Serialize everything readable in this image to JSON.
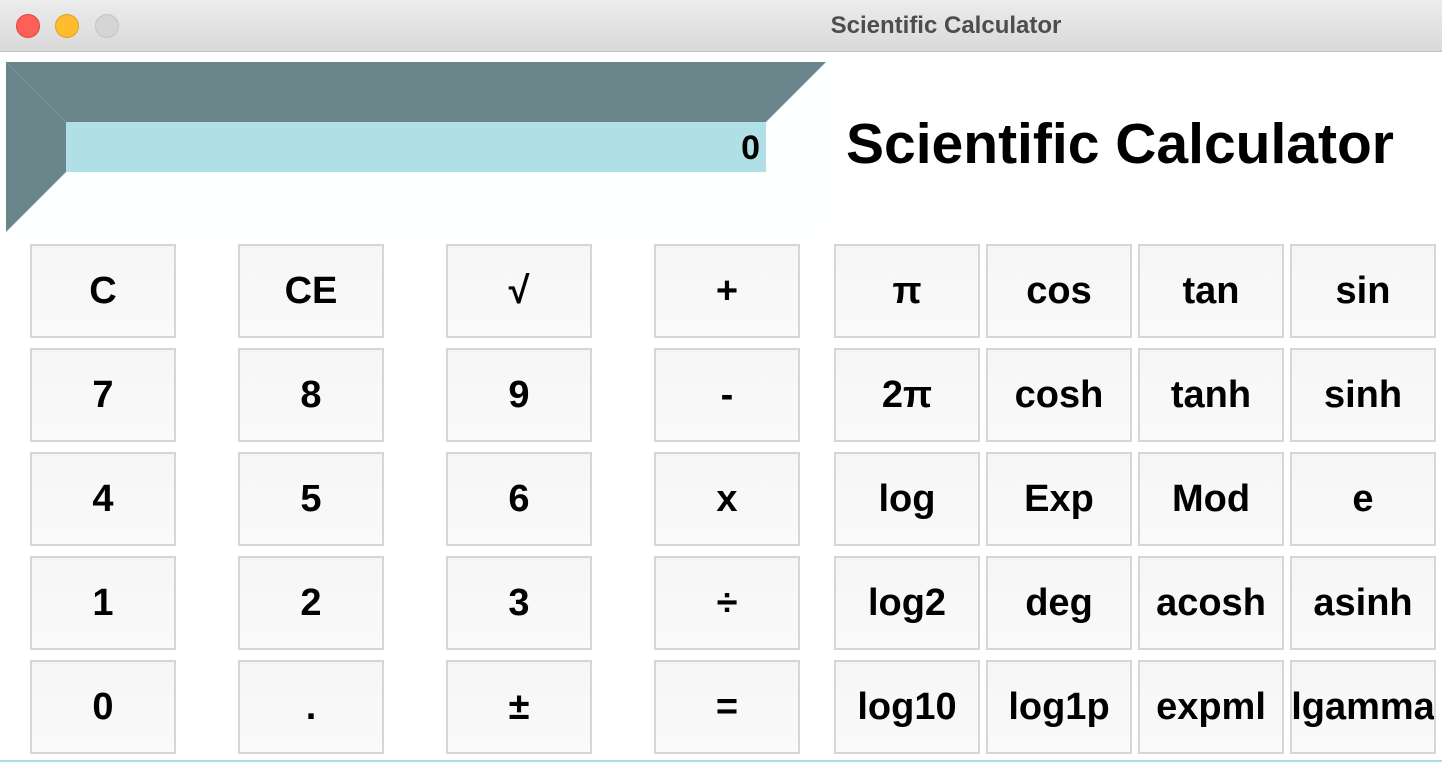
{
  "window": {
    "title": "Scientific Calculator"
  },
  "display": {
    "value": "0"
  },
  "heading": "Scientific Calculator",
  "colors": {
    "display_bg": "#b0dfe5",
    "frame_dark": "#6b868b",
    "frame_light": "#fbfffe"
  },
  "basic_buttons": [
    [
      "C",
      "CE",
      "√",
      "+"
    ],
    [
      "7",
      "8",
      "9",
      "-"
    ],
    [
      "4",
      "5",
      "6",
      "x"
    ],
    [
      "1",
      "2",
      "3",
      "÷"
    ],
    [
      "0",
      ".",
      "±",
      "="
    ]
  ],
  "scientific_buttons": [
    [
      "π",
      "cos",
      "tan",
      "sin"
    ],
    [
      "2π",
      "cosh",
      "tanh",
      "sinh"
    ],
    [
      "log",
      "Exp",
      "Mod",
      "e"
    ],
    [
      "log2",
      "deg",
      "acosh",
      "asinh"
    ],
    [
      "log10",
      "log1p",
      "expml",
      "lgamma"
    ]
  ]
}
